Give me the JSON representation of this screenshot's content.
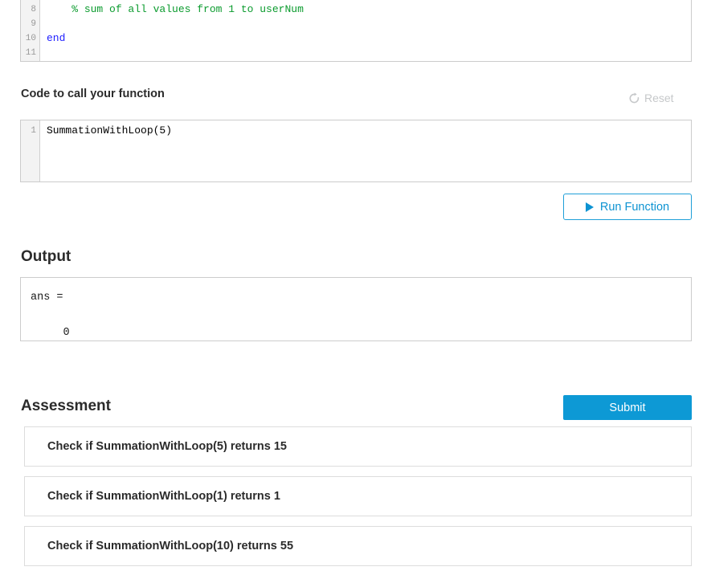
{
  "function_editor": {
    "name": "function-code-editor",
    "line_numbers": [
      "8",
      "9",
      "10",
      "11"
    ],
    "lines": [
      {
        "indent": "    ",
        "tokens": [
          {
            "text": "% sum of all values from 1 to userNum",
            "type": "comment"
          }
        ]
      },
      {
        "indent": "",
        "tokens": []
      },
      {
        "indent": "",
        "tokens": [
          {
            "text": "end",
            "type": "keyword"
          }
        ]
      },
      {
        "indent": "",
        "tokens": []
      }
    ]
  },
  "code_to_call": {
    "heading": "Code to call your function",
    "reset_label": "Reset",
    "reset_icon": "refresh-circular-arrow-icon",
    "line_numbers": [
      "1"
    ],
    "lines": [
      {
        "indent": "",
        "tokens": [
          {
            "text": "SummationWithLoop(5)",
            "type": "plain"
          }
        ]
      }
    ]
  },
  "run_function": {
    "label": "Run Function",
    "icon": "play-triangle-icon",
    "accent_color": "#0d93d2"
  },
  "output": {
    "heading": "Output",
    "lines": [
      "ans =",
      "",
      "     0"
    ]
  },
  "assessment": {
    "heading": "Assessment",
    "submit_label": "Submit",
    "submit_color": "#0d99d5",
    "tests": [
      {
        "label": "Check if SummationWithLoop(5) returns 15"
      },
      {
        "label": "Check if SummationWithLoop(1) returns 1"
      },
      {
        "label": "Check if SummationWithLoop(10) returns 55"
      }
    ]
  }
}
